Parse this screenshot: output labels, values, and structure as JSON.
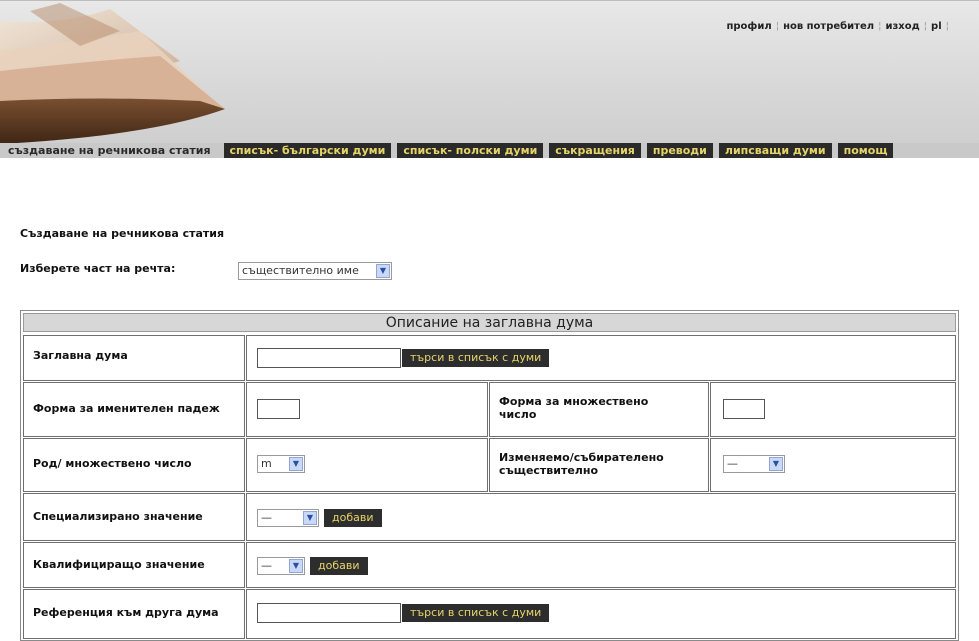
{
  "toplinks": {
    "profile": "профил",
    "new_user": "нов потребител",
    "logout": "изход",
    "lang": "pl"
  },
  "nav": {
    "active": "създаване на речникова статия",
    "bulgarian_list": "списък- български думи",
    "polish_list": "списък- полски думи",
    "abbreviations": "съкращения",
    "translations": "преводи",
    "missing_words": "липсващи думи",
    "help": "помощ"
  },
  "page": {
    "title": "Създаване на речникова статия",
    "pos_label": "Изберете част на речта:",
    "pos_value": "съществително име"
  },
  "form": {
    "caption": "Описание на заглавна дума",
    "headword_label": "Заглавна дума",
    "headword_value": "",
    "search_button": "търси в списък с думи",
    "nominative_label": "Форма за именителен падеж",
    "plural_label": "Форма за множествено число",
    "gender_label": "Род/ множествено число",
    "gender_value": "m",
    "collective_label": "Изменяемо/събирателено съществително",
    "collective_value": "—",
    "specialized_label": "Специализирано значение",
    "specialized_value": "—",
    "qualifying_label": "Квалифициращо значение",
    "qualifying_value": "—",
    "add_button": "добави",
    "reference_label": "Референция към друга дума",
    "reference_search_button": "търси в списък с думи"
  },
  "colors": {
    "nav_dark": "#2a2a2a",
    "nav_text": "#e6d46a",
    "nav_bg": "#c9c9c9"
  }
}
